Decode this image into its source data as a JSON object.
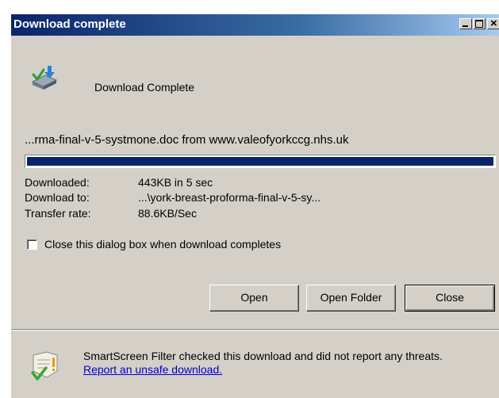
{
  "window": {
    "title": "Download complete",
    "close_glyph": "×"
  },
  "header": {
    "text": "Download Complete",
    "icon": "download-complete-icon"
  },
  "file": {
    "line": "...rma-final-v-5-systmone.doc from www.valeofyorkccg.nhs.uk"
  },
  "progress": {
    "percent": 100,
    "color": "#0a246a"
  },
  "info": {
    "downloaded_label": "Downloaded:",
    "downloaded_value": "443KB in 5 sec",
    "download_to_label": "Download to:",
    "download_to_value": "...\\york-breast-proforma-final-v-5-sy...",
    "transfer_rate_label": "Transfer rate:",
    "transfer_rate_value": "88.6KB/Sec"
  },
  "checkbox": {
    "label": "Close this dialog box when download completes",
    "checked": false
  },
  "buttons": {
    "open": "Open",
    "open_folder": "Open Folder",
    "close": "Close"
  },
  "smartscreen": {
    "text": "SmartScreen Filter checked this download and did not report any threats.",
    "link": "Report an unsafe download.",
    "icon": "smartscreen-shield-icon"
  },
  "colors": {
    "title_gradient_start": "#0a246a",
    "dialog_background": "#d4d0c8",
    "link": "#0000cc"
  }
}
